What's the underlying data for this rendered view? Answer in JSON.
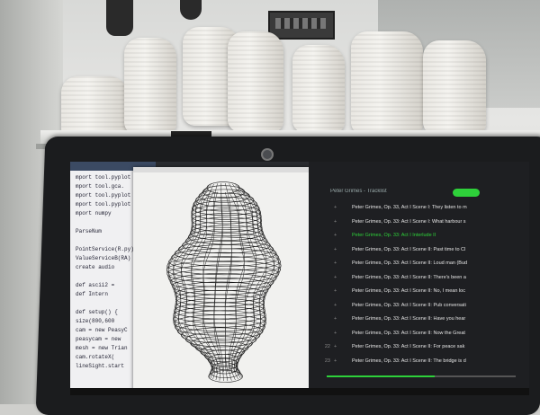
{
  "editor": {
    "lines": [
      "mport tool.pyplot",
      "mport tool.gca.",
      "mport tool.pyplot",
      "mport tool.pyplot",
      "mport numpy",
      "",
      "ParseNum",
      "",
      "PointService(R.py)",
      "ValueServiceB(RA)",
      "create audio",
      "",
      "def ascii2 = ",
      "def Intern",
      "",
      "def setup() {",
      "  size(800,600",
      "  cam = new PeasyC",
      "  peasycam = new",
      "  mesh = new Trian",
      "  cam.rotateX(",
      "  lineSight.start"
    ]
  },
  "player": {
    "header": "Peter Grimes - Tracklist",
    "tracks": [
      {
        "num": "",
        "title": "Peter Grimes, Op. 33, Act I Scene I: They listen to m"
      },
      {
        "num": "",
        "title": "Peter Grimes, Op. 33: Act I Scene I: What harbour s"
      },
      {
        "num": "",
        "title": "Peter Grimes, Op. 33: Act I Interlude II",
        "playing": true
      },
      {
        "num": "",
        "title": "Peter Grimes, Op. 33: Act I Scene II: Past time to Cl"
      },
      {
        "num": "",
        "title": "Peter Grimes, Op. 33: Act I Scene II: Loud man (Bud"
      },
      {
        "num": "",
        "title": "Peter Grimes, Op. 33: Act I Scene II: There's been a"
      },
      {
        "num": "",
        "title": "Peter Grimes, Op. 33: Act I Scene II: No, I mean loc"
      },
      {
        "num": "",
        "title": "Peter Grimes, Op. 33: Act I Scene II: Pub conversati"
      },
      {
        "num": "",
        "title": "Peter Grimes, Op. 33: Act I Scene II: Have you hear"
      },
      {
        "num": "",
        "title": "Peter Grimes, Op. 33: Act I Scene II: Now the Great"
      },
      {
        "num": "22",
        "title": "Peter Grimes, Op. 33: Act I Scene II: For peace sak"
      },
      {
        "num": "23",
        "title": "Peter Grimes, Op. 33: Act I Scene II: The bridge is d"
      }
    ],
    "progress_fraction": 0.57
  }
}
